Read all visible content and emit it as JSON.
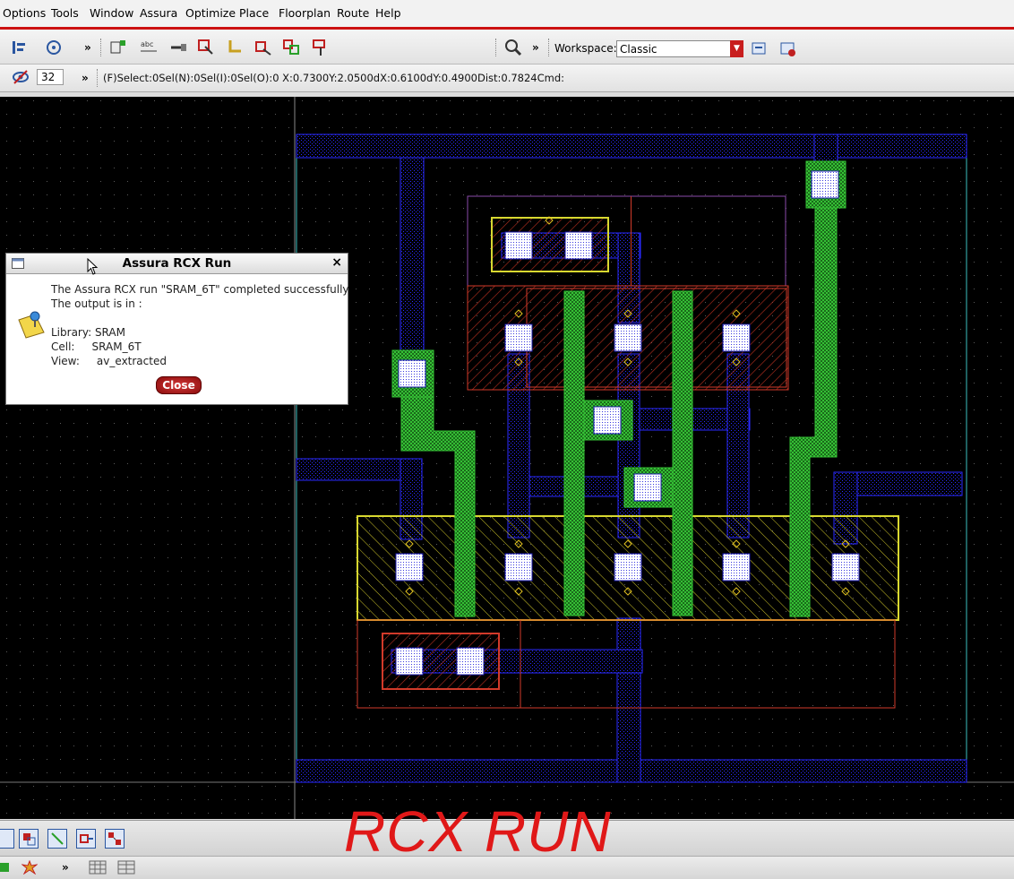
{
  "menu": {
    "items": [
      "Options",
      "Tools",
      "Window",
      "Assura",
      "Optimize",
      "Place",
      "Floorplan",
      "Route",
      "Help"
    ]
  },
  "toolbar": {
    "more": "»",
    "workspace_label": "Workspace:",
    "workspace_value": "Classic",
    "zoom_value": "32"
  },
  "status": {
    "text": "(F)Select:0Sel(N):0Sel(I):0Sel(O):0   X:0.7300Y:2.0500dX:0.6100dY:0.4900Dist:0.7824Cmd:"
  },
  "dialog": {
    "title": "Assura RCX Run",
    "close_x": "×",
    "line1": "The Assura RCX run \"SRAM_6T\" completed successfully",
    "line2": "The output is in :",
    "library": "Library: SRAM",
    "cell": "Cell:     SRAM_6T",
    "view": "View:     av_extracted",
    "close_button": "Close"
  },
  "banner": {
    "text": "RCX RUN"
  },
  "colors": {
    "accent_red": "#cc1111",
    "metal_blue": "#1a1aff",
    "poly_green": "#22b022",
    "diffusion_red": "#d23a2a",
    "nwell_yellow": "#d8d830",
    "contact_white": "#ffffff",
    "grid_dot": "#5a5a5a"
  },
  "icons": [
    "layer-palette-icon",
    "undo-icon",
    "create-instance-icon",
    "label-icon",
    "wire-icon",
    "select-icon",
    "path-icon",
    "move-icon",
    "copy-icon",
    "stretch-icon",
    "zoom-icon",
    "workspace-save-icon",
    "workspace-load-icon",
    "eye-icon",
    "info-icon",
    "vertical-align-icon",
    "horizontal-align-icon",
    "fit-icon",
    "zoom-in-icon",
    "zoom-out-icon",
    "grid-icon",
    "table-icon"
  ]
}
